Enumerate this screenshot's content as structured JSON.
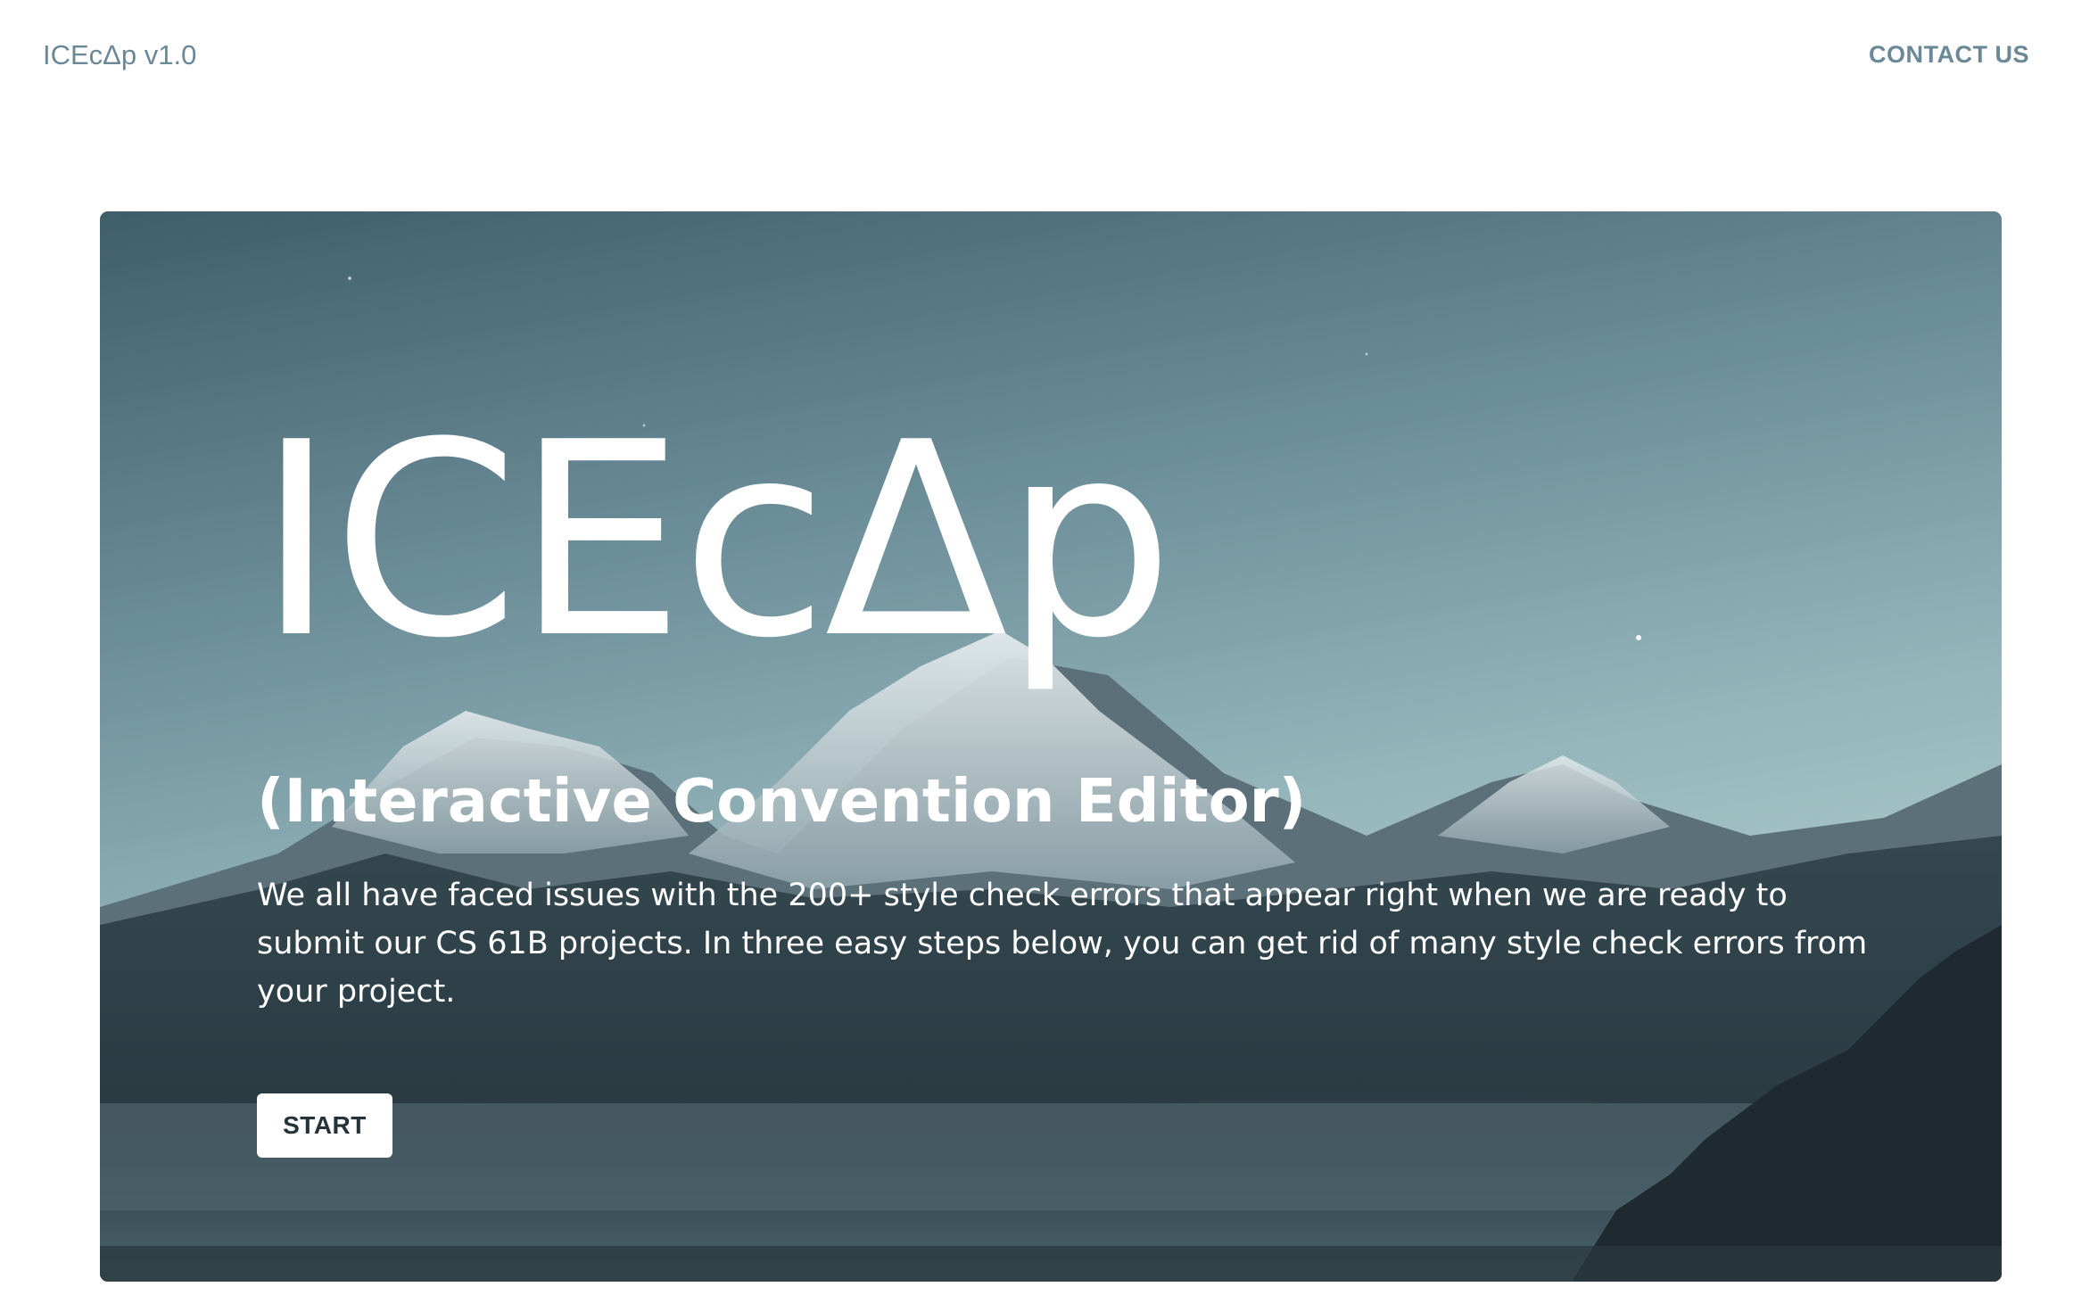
{
  "header": {
    "brand": "ICEcΔp v1.0",
    "contact_label": "CONTACT US"
  },
  "hero": {
    "title": "ICEcΔp",
    "subtitle": "(Interactive Convention Editor)",
    "description": "We all have faced issues with the 200+ style check errors that appear right when we are ready to submit our CS 61B projects. In three easy steps below, you can get rid of many style check errors from your project.",
    "start_label": "START",
    "background_image": "snow-capped-mountains-photo"
  },
  "colors": {
    "nav_text": "#6a8896",
    "hero_text": "#ffffff",
    "button_bg": "#ffffff",
    "button_text": "#25323a",
    "sky_top": "#3f5e6a",
    "sky_bottom": "#c9dcd8",
    "mountain_dark": "#2b3d44"
  }
}
